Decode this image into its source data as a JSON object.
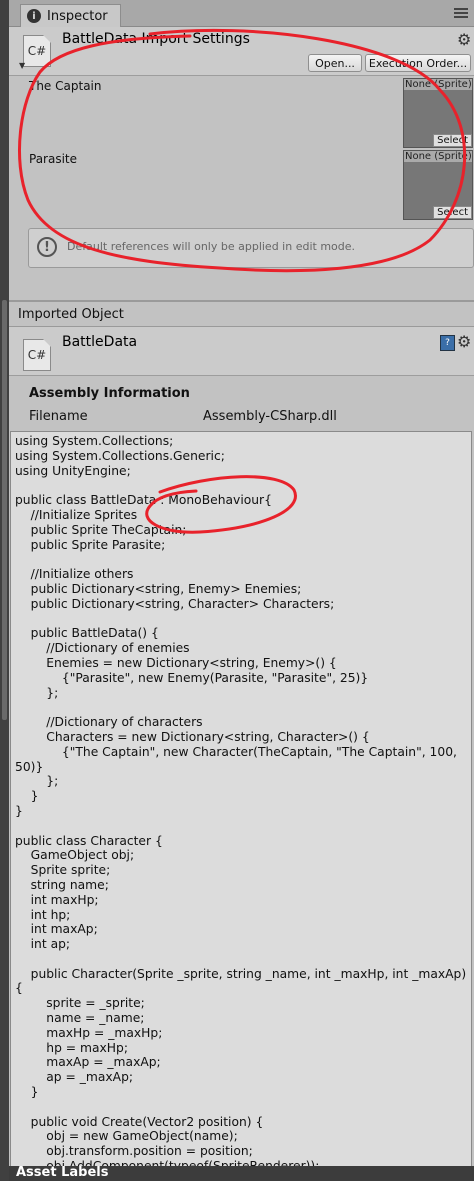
{
  "tab": {
    "label": "Inspector"
  },
  "import_settings": {
    "icon_text": "C#",
    "title": "BattleData Import Settings",
    "open_label": "Open...",
    "execution_order_label": "Execution Order..."
  },
  "references": [
    {
      "label": "The Captain",
      "value": "None (Sprite)",
      "select_label": "Select"
    },
    {
      "label": "Parasite",
      "value": "None (Sprite)",
      "select_label": "Select"
    }
  ],
  "help_message": "Default references will only be applied in edit mode.",
  "imported_object": {
    "header": "Imported Object",
    "icon_text": "C#",
    "title": "BattleData"
  },
  "assembly": {
    "header": "Assembly Information",
    "filename_label": "Filename",
    "filename_value": "Assembly-CSharp.dll"
  },
  "source_code": "using System.Collections;\nusing System.Collections.Generic;\nusing UnityEngine;\n\npublic class BattleData : MonoBehaviour{\n    //Initialize Sprites\n    public Sprite TheCaptain;\n    public Sprite Parasite;\n\n    //Initialize others\n    public Dictionary<string, Enemy> Enemies;\n    public Dictionary<string, Character> Characters;\n\n    public BattleData() {\n        //Dictionary of enemies\n        Enemies = new Dictionary<string, Enemy>() {\n            {\"Parasite\", new Enemy(Parasite, \"Parasite\", 25)}\n        };\n\n        //Dictionary of characters\n        Characters = new Dictionary<string, Character>() {\n            {\"The Captain\", new Character(TheCaptain, \"The Captain\", 100,\n50)}\n        };\n    }\n}\n\npublic class Character {\n    GameObject obj;\n    Sprite sprite;\n    string name;\n    int maxHp;\n    int hp;\n    int maxAp;\n    int ap;\n\n    public Character(Sprite _sprite, string _name, int _maxHp, int _maxAp)\n{\n        sprite = _sprite;\n        name = _name;\n        maxHp = _maxHp;\n        hp = maxHp;\n        maxAp = _maxAp;\n        ap = _maxAp;\n    }\n\n    public void Create(Vector2 position) {\n        obj = new GameObject(name);\n        obj.transform.position = position;\n        obj.AddComponent(typeof(SpriteRenderer));\n        obj.GetComponent<SpriteRenderer>().sprite = sprite;",
  "footer": {
    "asset_labels": "Asset Labels"
  },
  "colors": {
    "annotation_red": "#e8222b",
    "panel_bg": "#c2c2c2",
    "code_bg": "#dcdcdc"
  }
}
